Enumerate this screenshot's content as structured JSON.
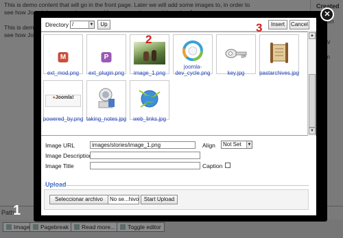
{
  "background": {
    "editor_line1": "This is demo content that will go in the front page. Later we will add some images to, in order to",
    "editor_line2": "see how Joomla! manages images and how can we improve it by using Jquery.",
    "editor_line3": "This is demo",
    "editor_line4": "see how Joom",
    "side_label1": "Created",
    "side_label2": "ublish",
    "side_label3": "(Adv",
    "side_label4": "form",
    "path_label": "Path:",
    "buttons": [
      "Image",
      "Pagebreak",
      "Read more...",
      "Toggle editor"
    ]
  },
  "dialog": {
    "directory_label": "Directory",
    "directory_value": "/",
    "up_label": "Up",
    "insert_label": "Insert",
    "cancel_label": "Cancel",
    "images": [
      {
        "name": "ext_mod.png",
        "icon": "module-icon",
        "letter": "M",
        "color": "#c8503c"
      },
      {
        "name": "ext_plugin.png",
        "icon": "plugin-icon",
        "letter": "P",
        "color": "#9b59b6"
      },
      {
        "name": "image_1.png",
        "icon": "photo-icon"
      },
      {
        "name": "joomla-dev_cycle.png",
        "icon": "cycle-diagram-icon"
      },
      {
        "name": "key.jpg",
        "icon": "key-icon"
      },
      {
        "name": "pastarchives.jpg",
        "icon": "scroll-icon"
      },
      {
        "name": "powered_by.png",
        "icon": "joomla-logo-icon"
      },
      {
        "name": "taking_notes.jpg",
        "icon": "notes-icon"
      },
      {
        "name": "web_links.jpg",
        "icon": "globe-icon"
      }
    ],
    "form": {
      "url_label": "Image URL",
      "url_value": "images/stories/image_1.png",
      "align_label": "Align",
      "align_value": "Not Set",
      "description_label": "Image Description",
      "title_label": "Image Title",
      "caption_label": "Caption"
    },
    "upload": {
      "title": "Upload",
      "choose_button": "Seleccionar archivo",
      "no_file_text": "No se...hivo",
      "start_button": "Start Upload"
    }
  },
  "annotations": {
    "one": "1",
    "two": "2",
    "three": "3"
  },
  "close_symbol": "✕"
}
